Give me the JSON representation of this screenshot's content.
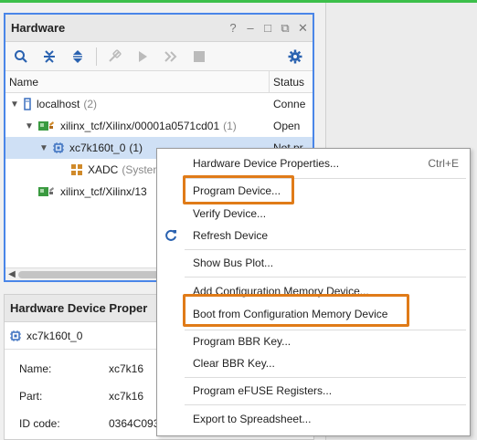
{
  "hardware": {
    "title": "Hardware",
    "win_controls": {
      "help": "?",
      "minimize": "–",
      "restore": "□",
      "float": "⧉",
      "close": "✕"
    },
    "columns": {
      "name": "Name",
      "status": "Status"
    },
    "tree": [
      {
        "label": "localhost",
        "count": "(2)",
        "status": "Conne"
      },
      {
        "label": "xilinx_tcf/Xilinx/00001a0571cd01",
        "count": "(1)",
        "status": "Open"
      },
      {
        "label": "xc7k160t_0",
        "count": "(1)",
        "status": "Not pr"
      },
      {
        "label": "XADC",
        "count": "(System"
      },
      {
        "label": "xilinx_tcf/Xilinx/13"
      }
    ]
  },
  "properties": {
    "title": "Hardware Device Proper",
    "object": "xc7k160t_0",
    "rows": [
      {
        "key": "Name:",
        "value": "xc7k16"
      },
      {
        "key": "Part:",
        "value": "xc7k16"
      },
      {
        "key": "ID code:",
        "value": "0364C093"
      }
    ]
  },
  "context_menu": {
    "items": [
      {
        "label": "Hardware Device Properties...",
        "shortcut": "Ctrl+E"
      },
      {
        "label": "Program Device..."
      },
      {
        "label": "Verify Device..."
      },
      {
        "label": "Refresh Device",
        "icon": "refresh-icon"
      },
      {
        "label": "Show Bus Plot..."
      },
      {
        "label": "Add Configuration Memory Device..."
      },
      {
        "label": "Boot from Configuration Memory Device"
      },
      {
        "label": "Program BBR Key..."
      },
      {
        "label": "Clear BBR Key..."
      },
      {
        "label": "Program eFUSE Registers..."
      },
      {
        "label": "Export to Spreadsheet..."
      }
    ]
  },
  "colors": {
    "accent_blue": "#4a86e8",
    "highlight_orange": "#e07b18",
    "selection": "#cfe0f5"
  }
}
